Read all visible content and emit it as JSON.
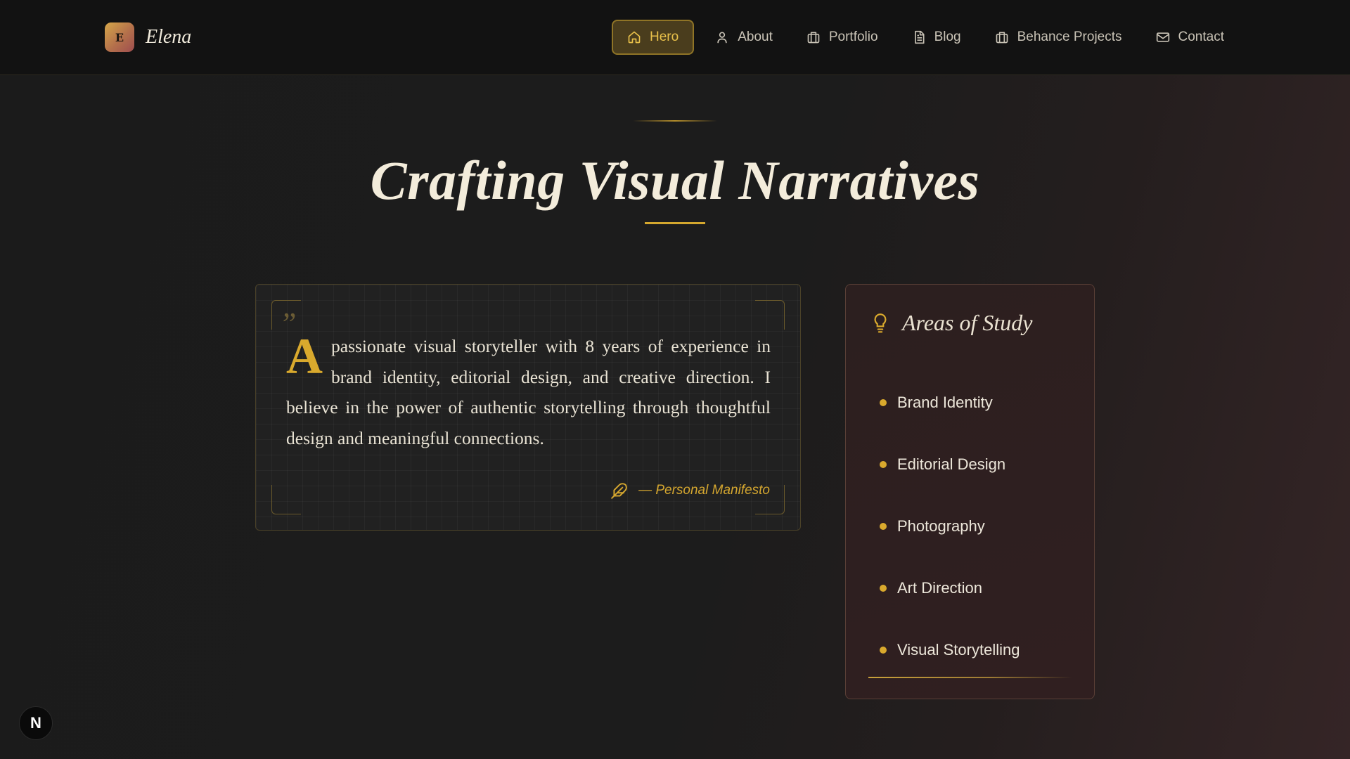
{
  "brand": {
    "logo_letter": "E",
    "name": "Elena"
  },
  "nav": {
    "items": [
      {
        "label": "Hero",
        "icon": "home-icon",
        "active": true
      },
      {
        "label": "About",
        "icon": "user-icon",
        "active": false
      },
      {
        "label": "Portfolio",
        "icon": "briefcase-icon",
        "active": false
      },
      {
        "label": "Blog",
        "icon": "document-icon",
        "active": false
      },
      {
        "label": "Behance Projects",
        "icon": "briefcase-icon",
        "active": false
      },
      {
        "label": "Contact",
        "icon": "mail-icon",
        "active": false
      }
    ]
  },
  "hero": {
    "title": "Crafting Visual Narratives"
  },
  "manifesto": {
    "quote_mark": "”",
    "drop_cap": "A",
    "text": "passionate visual storyteller with 8 years of experience in brand identity, editorial design, and creative direction. I believe in the power of authentic storytelling through thoughtful design and meaningful connections.",
    "signature": "— Personal Manifesto",
    "signature_icon": "feather-icon"
  },
  "areas": {
    "title": "Areas of Study",
    "icon": "lightbulb-icon",
    "items": [
      "Brand Identity",
      "Editorial Design",
      "Photography",
      "Art Direction",
      "Visual Storytelling"
    ]
  },
  "badge": {
    "letter": "N"
  },
  "colors": {
    "accent": "#d9a92d",
    "background": "#1b1b1b",
    "nav_bg": "#121212",
    "card_bg": "#2c1f1f"
  }
}
